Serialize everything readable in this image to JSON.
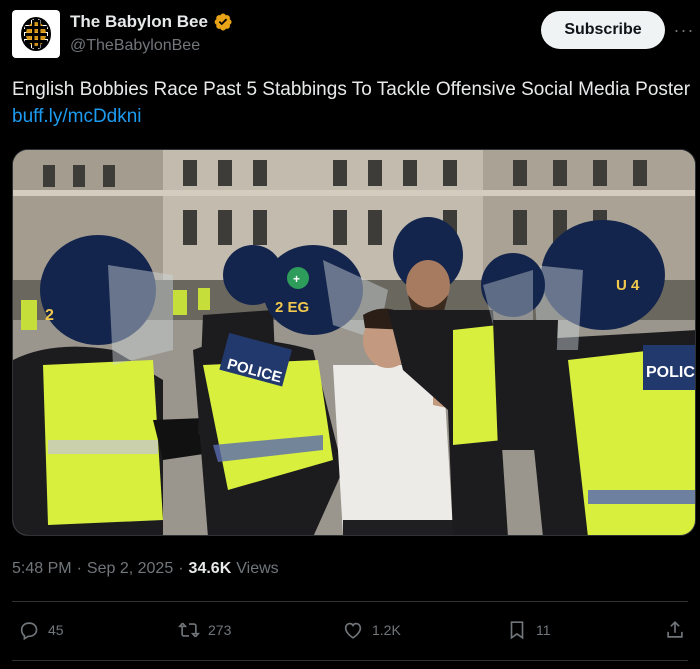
{
  "post": {
    "author_name": "The Babylon Bee",
    "author_handle": "@TheBabylonBee",
    "subscribe_label": "Subscribe",
    "more_label": "···",
    "text": "English Bobbies Race Past 5 Stabbings To Tackle Offensive Social Media Poster ",
    "link_text": "buff.ly/mcDdkni",
    "time": "5:48 PM",
    "date": "Sep 2, 2025",
    "views_count": "34.6K",
    "views_label": "Views",
    "separator": "·"
  },
  "media": {
    "vest_label_left": "POLICE",
    "vest_label_right": "POLIC",
    "helmet_code_center": "2 EG",
    "helmet_code_right": "U 4",
    "helmet_number_left": "2"
  },
  "actions": {
    "replies": "45",
    "reposts": "273",
    "likes": "1.2K",
    "bookmarks": "11"
  },
  "colors": {
    "background": "#000000",
    "link": "#1d9bf0",
    "muted": "#71767b",
    "verified_badge": "#e8a317"
  },
  "icons": [
    "babylon-bee-logo-icon",
    "verified-badge-icon",
    "more-icon",
    "reply-icon",
    "repost-icon",
    "like-icon",
    "bookmark-icon",
    "share-icon"
  ]
}
